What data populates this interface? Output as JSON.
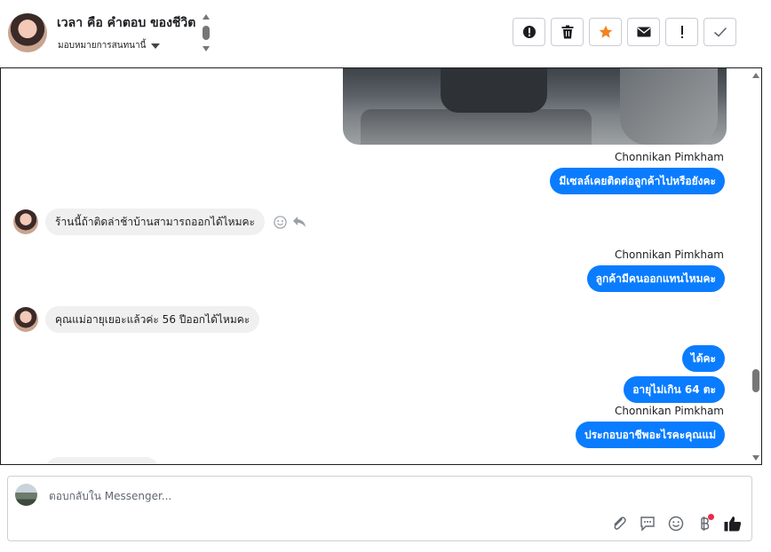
{
  "header": {
    "title": "เวลา คือ คำตอบ ของชีวิต",
    "subtitle": "มอบหมายการสนทนานี้",
    "toolbar": [
      {
        "name": "alert-icon"
      },
      {
        "name": "trash-icon"
      },
      {
        "name": "star-icon",
        "color": "#f5821f"
      },
      {
        "name": "mail-icon"
      },
      {
        "name": "exclamation-icon"
      },
      {
        "name": "check-icon"
      }
    ]
  },
  "messages": {
    "sender1": "Chonnikan Pimkham",
    "out1": "มีเซลล์เคยติดต่อลูกค้าไปหรือยังคะ",
    "in1": "ร้านนี้ถ้าติดล่าช้าบ้านสามารถออกได้ไหมคะ",
    "sender2": "Chonnikan Pimkham",
    "out2": "ลูกค้ามีคนออกแทนไหมคะ",
    "in2": "คุณแม่อายุเยอะแล้วค่ะ 56 ปีออกได้ไหมคะ",
    "out3": "ได้คะ",
    "out4": "อายุไม่เกิน 64 ตะ",
    "sender3": "Chonnikan Pimkham",
    "out5": "ประกอบอาชีพอะไรคะคุณแม่"
  },
  "composer": {
    "placeholder": "ตอบกลับใน Messenger..."
  },
  "colors": {
    "outgoing_bubble": "#0a7cff",
    "incoming_bubble": "#f0f0f0",
    "badge": "#f02849"
  }
}
